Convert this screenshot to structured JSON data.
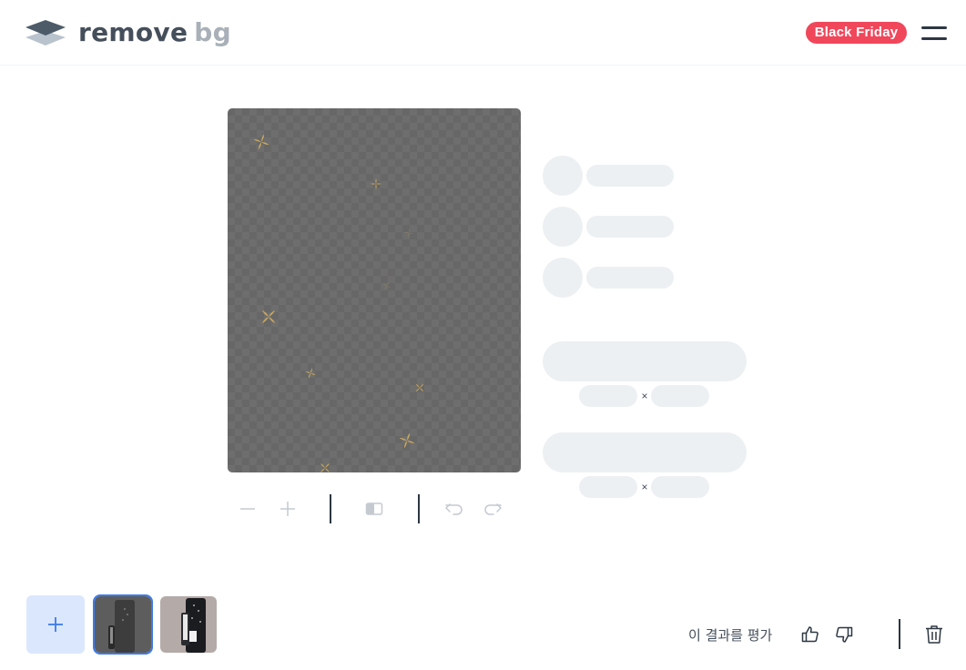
{
  "header": {
    "logo_word1": "remove",
    "logo_word2": "bg",
    "promo_badge": "Black Friday",
    "menu_icon": "hamburger-menu-icon"
  },
  "editor": {
    "canvas_state": "processing",
    "toolbar": {
      "zoom_out_icon": "minus-icon",
      "zoom_in_icon": "plus-icon",
      "compare_icon": "compare-icon",
      "undo_icon": "undo-icon",
      "redo_icon": "redo-icon"
    }
  },
  "sidebar": {
    "state": "loading-skeleton",
    "size_separator_1": "×",
    "size_separator_2": "×"
  },
  "bottom_bar": {
    "add_icon": "plus-icon",
    "thumbnails": [
      {
        "name": "image-1",
        "selected": true
      },
      {
        "name": "image-2",
        "selected": false
      }
    ],
    "rate_label": "이 결과를 평가",
    "thumbs_up_icon": "thumbs-up-icon",
    "thumbs_down_icon": "thumbs-down-icon",
    "delete_icon": "trash-icon"
  },
  "colors": {
    "accent": "#3c7bea",
    "promo": "#f0475b",
    "text": "#454f5b",
    "skeleton": "#edf0f3"
  }
}
